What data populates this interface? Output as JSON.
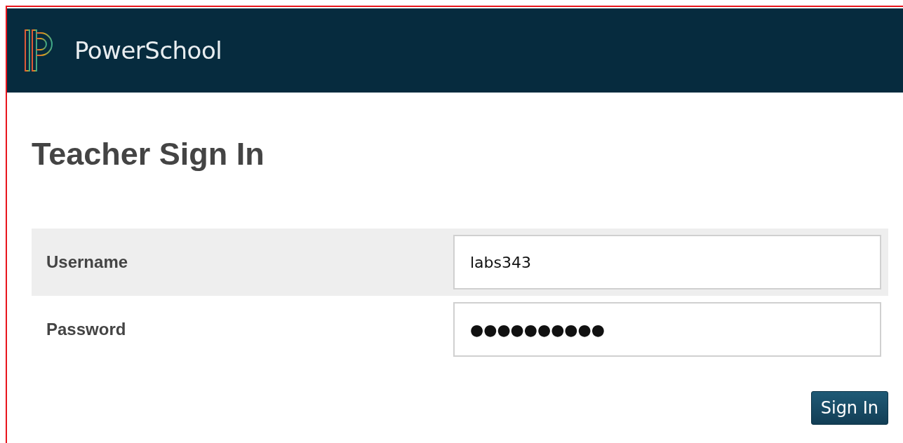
{
  "header": {
    "brand": "PowerSchool"
  },
  "title": "Teacher Sign In",
  "fields": [
    {
      "label": "Username",
      "value": "labs343",
      "shaded": true
    },
    {
      "label": "Password",
      "value": "●●●●●●●●●●",
      "shaded": false
    }
  ],
  "submit": {
    "label": "Sign In"
  }
}
